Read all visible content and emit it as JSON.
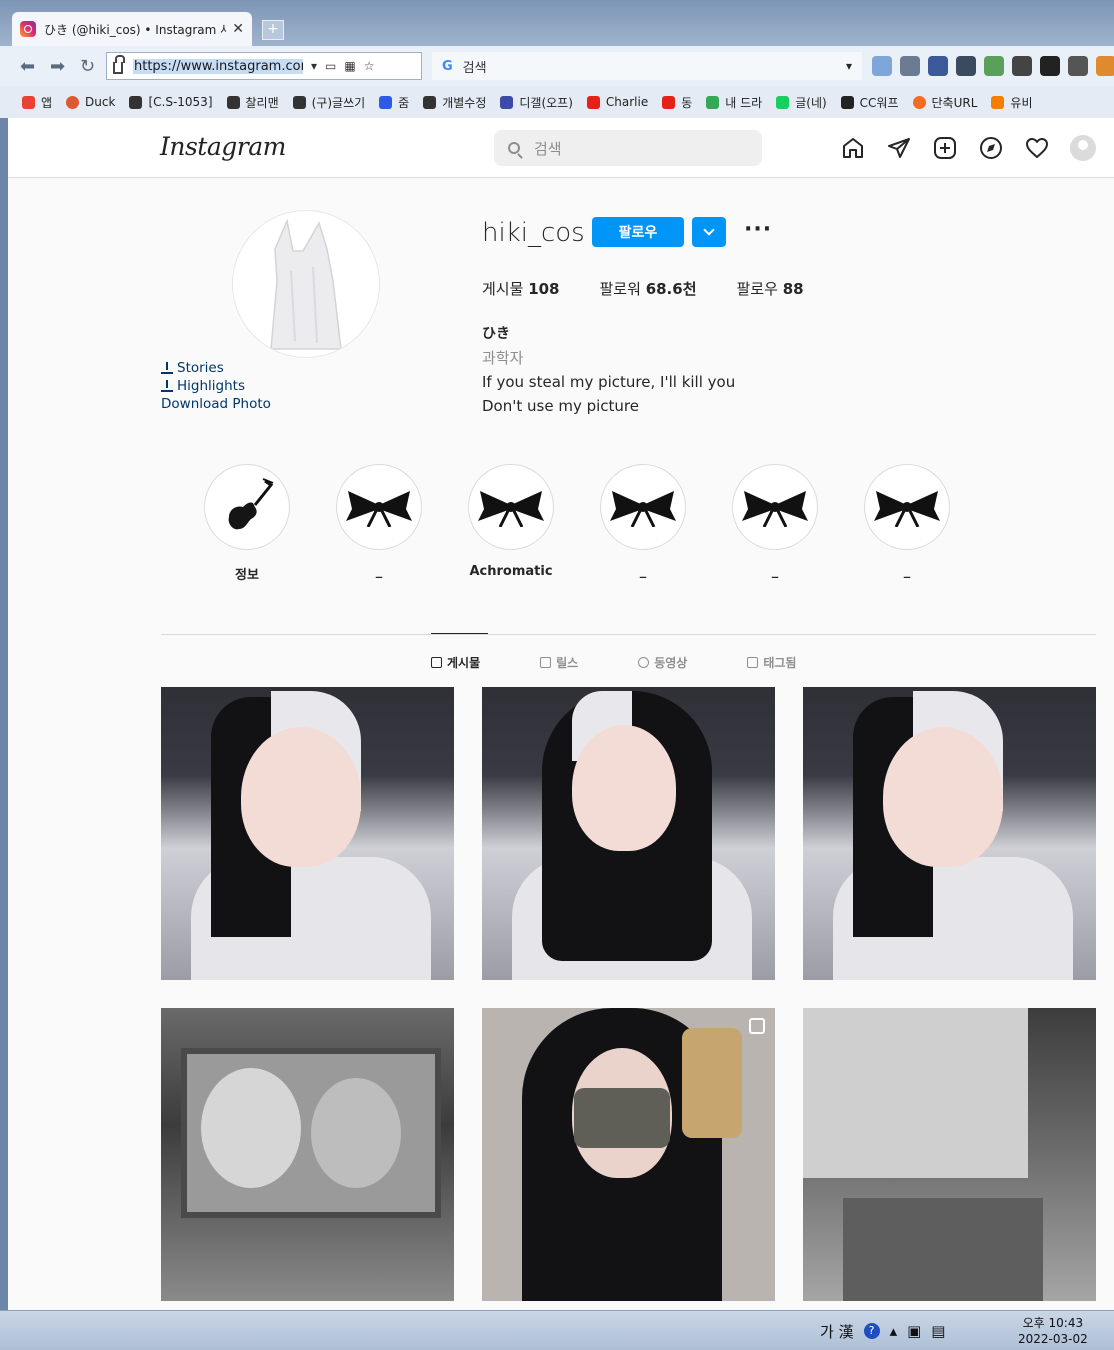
{
  "browser": {
    "tab_title": "ひき (@hiki_cos) • Instagram 사진",
    "tab_close": "✕",
    "url": "https://www.instagram.con",
    "search_placeholder": "검색",
    "search_engine": "G"
  },
  "bookmarks": [
    {
      "label": "앱"
    },
    {
      "label": "Duck"
    },
    {
      "label": "[C.S-1053]"
    },
    {
      "label": "찰리맨"
    },
    {
      "label": "(구)글쓰기"
    },
    {
      "label": "줌"
    },
    {
      "label": "개별수정"
    },
    {
      "label": "디갤(오프)"
    },
    {
      "label": "Charlie"
    },
    {
      "label": "동"
    },
    {
      "label": "내 드라"
    },
    {
      "label": "글(네)"
    },
    {
      "label": "CC워프"
    },
    {
      "label": "단축URL"
    },
    {
      "label": "유비"
    }
  ],
  "instagram": {
    "logo": "Instagram",
    "search_placeholder": "검색"
  },
  "profile": {
    "username": "hiki_cos",
    "follow_label": "팔로우",
    "more_label": "···",
    "stats": {
      "posts_label": "게시물",
      "posts_value": "108",
      "followers_label": "팔로워",
      "followers_value": "68.6천",
      "following_label": "팔로우",
      "following_value": "88"
    },
    "display_name": "ひき",
    "category": "과학자",
    "bio_line1": "If you steal my picture, I'll kill you",
    "bio_line2": "Don't use my picture",
    "links": {
      "stories": "Stories",
      "highlights": "Highlights",
      "download_photo": "Download Photo"
    }
  },
  "highlights": [
    {
      "label": "정보",
      "icon": "guitar-icon"
    },
    {
      "label": "_",
      "icon": "ribbon-bow-icon"
    },
    {
      "label": "Achromatic",
      "icon": "ribbon-bow-icon"
    },
    {
      "label": "_",
      "icon": "ribbon-bow-icon"
    },
    {
      "label": "_",
      "icon": "ribbon-bow-icon"
    },
    {
      "label": "_",
      "icon": "ribbon-bow-icon"
    }
  ],
  "tabs": [
    {
      "label": "게시물",
      "active": true
    },
    {
      "label": "릴스",
      "active": false
    },
    {
      "label": "동영상",
      "active": false
    },
    {
      "label": "태그됨",
      "active": false
    }
  ],
  "taskbar": {
    "ime": "가 漢",
    "time": "오후 10:43",
    "date": "2022-03-02"
  },
  "colors": {
    "accent": "#0095f6",
    "link": "#00376b"
  }
}
